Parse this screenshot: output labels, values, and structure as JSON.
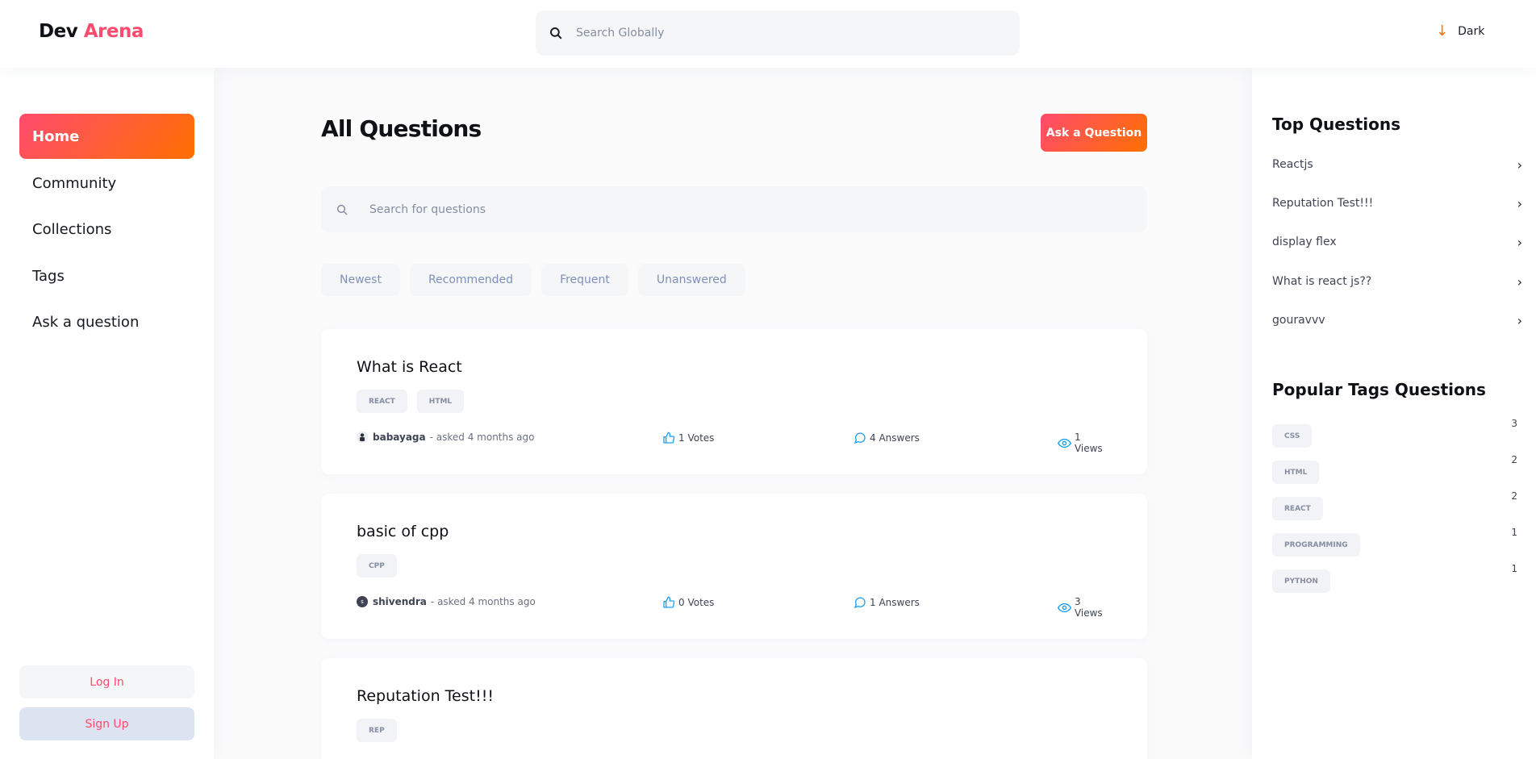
{
  "app": {
    "logo_primary": "Dev",
    "logo_accent": "Arena"
  },
  "header": {
    "search_placeholder": "Search Globally",
    "theme_label": "Dark"
  },
  "sidebar": {
    "items": [
      {
        "label": "Home",
        "active": true
      },
      {
        "label": "Community"
      },
      {
        "label": "Collections"
      },
      {
        "label": "Tags"
      },
      {
        "label": "Ask a question"
      }
    ],
    "login_label": "Log In",
    "signup_label": "Sign Up"
  },
  "main": {
    "title": "All Questions",
    "ask_button": "Ask a Question",
    "search_placeholder": "Search for questions",
    "filters": [
      "Newest",
      "Recommended",
      "Frequent",
      "Unanswered"
    ],
    "questions": [
      {
        "title": "What is React",
        "tags": [
          "REACT",
          "HTML"
        ],
        "author": "babayaga",
        "asked": "- asked 4 months ago",
        "votes": "1 Votes",
        "answers": "4 Answers",
        "views": "1 Views"
      },
      {
        "title": "basic of cpp",
        "tags": [
          "CPP"
        ],
        "author": "shivendra",
        "asked": "- asked 4 months ago",
        "votes": "0 Votes",
        "answers": "1 Answers",
        "views": "3 Views"
      },
      {
        "title": "Reputation Test!!!",
        "tags": [
          "REP"
        ]
      }
    ]
  },
  "rightbar": {
    "top_questions_title": "Top Questions",
    "top_questions": [
      "Reactjs",
      "Reputation Test!!!",
      "display flex",
      "What is react js??",
      "gouravvv"
    ],
    "popular_tags_title": "Popular Tags Questions",
    "popular_tags": [
      {
        "name": "CSS",
        "count": "3"
      },
      {
        "name": "HTML",
        "count": "2"
      },
      {
        "name": "REACT",
        "count": "2"
      },
      {
        "name": "PROGRAMMING",
        "count": "1"
      },
      {
        "name": "PYTHON",
        "count": "1"
      }
    ]
  },
  "colors": {
    "accent_start": "#ff4b6e",
    "accent_end": "#ff7000",
    "stat_icon": "#1da1f2"
  },
  "icons": {
    "search": "search-icon",
    "theme": "arrow-down-icon",
    "votes": "thumbs-up-icon",
    "answers": "message-icon",
    "views": "eye-icon",
    "chevron": "chevron-right-icon"
  }
}
